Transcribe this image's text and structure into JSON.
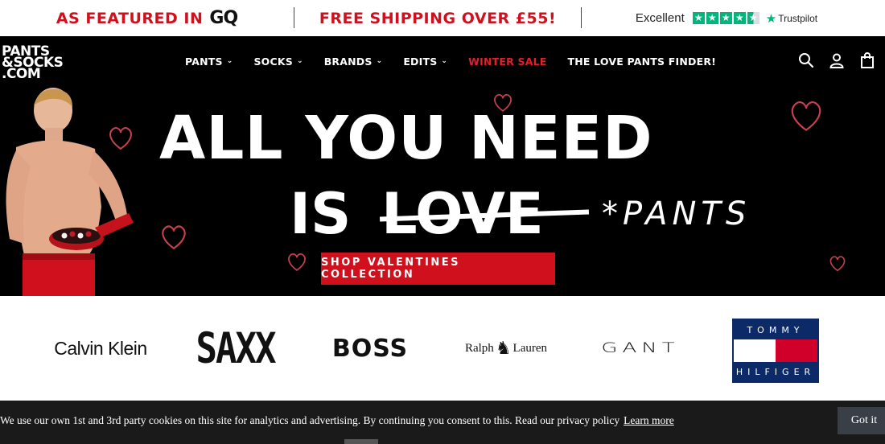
{
  "promo": {
    "featured_text": "AS FEATURED IN",
    "featured_brand": "GQ",
    "shipping_text": "FREE SHIPPING OVER £55!",
    "trustpilot_rating": "Excellent",
    "trustpilot_stars": 4.5,
    "trustpilot_label": "Trustpilot"
  },
  "header": {
    "logo_line1": "PANTS",
    "logo_line2": "&SOCKS",
    "logo_line3": ".COM",
    "menu": [
      {
        "label": "PANTS",
        "has_dropdown": true
      },
      {
        "label": "SOCKS",
        "has_dropdown": true
      },
      {
        "label": "BRANDS",
        "has_dropdown": true
      },
      {
        "label": "EDITS",
        "has_dropdown": true
      },
      {
        "label": "WINTER SALE",
        "has_dropdown": false
      },
      {
        "label": "THE LOVE PANTS FINDER!",
        "has_dropdown": false
      }
    ],
    "icons": [
      "search-icon",
      "account-icon",
      "bag-icon"
    ]
  },
  "hero": {
    "line1": "ALL YOU NEED",
    "line2_is": "IS",
    "line2_struck": "LOVE",
    "line2_replacement": "*PANTS",
    "cta": "SHOP VALENTINES COLLECTION"
  },
  "brands": {
    "calvin_klein": "Calvin Klein",
    "saxx": "SAXX",
    "boss": "BOSS",
    "ralph_lauren_1": "Ralph",
    "ralph_lauren_2": "Lauren",
    "gant": "GANT",
    "tommy_top": "TOMMY",
    "tommy_bottom": "HILFIGER"
  },
  "cookie": {
    "text": "We use our own 1st and 3rd party cookies on this site for analytics and advertising. By continuing you consent to this. Read our privacy policy",
    "link": "Learn more",
    "button": "Got it"
  },
  "colors": {
    "brand_red": "#d0101c",
    "trustpilot_green": "#00b67a",
    "tommy_navy": "#0b2a67",
    "tommy_red": "#d1002b"
  }
}
